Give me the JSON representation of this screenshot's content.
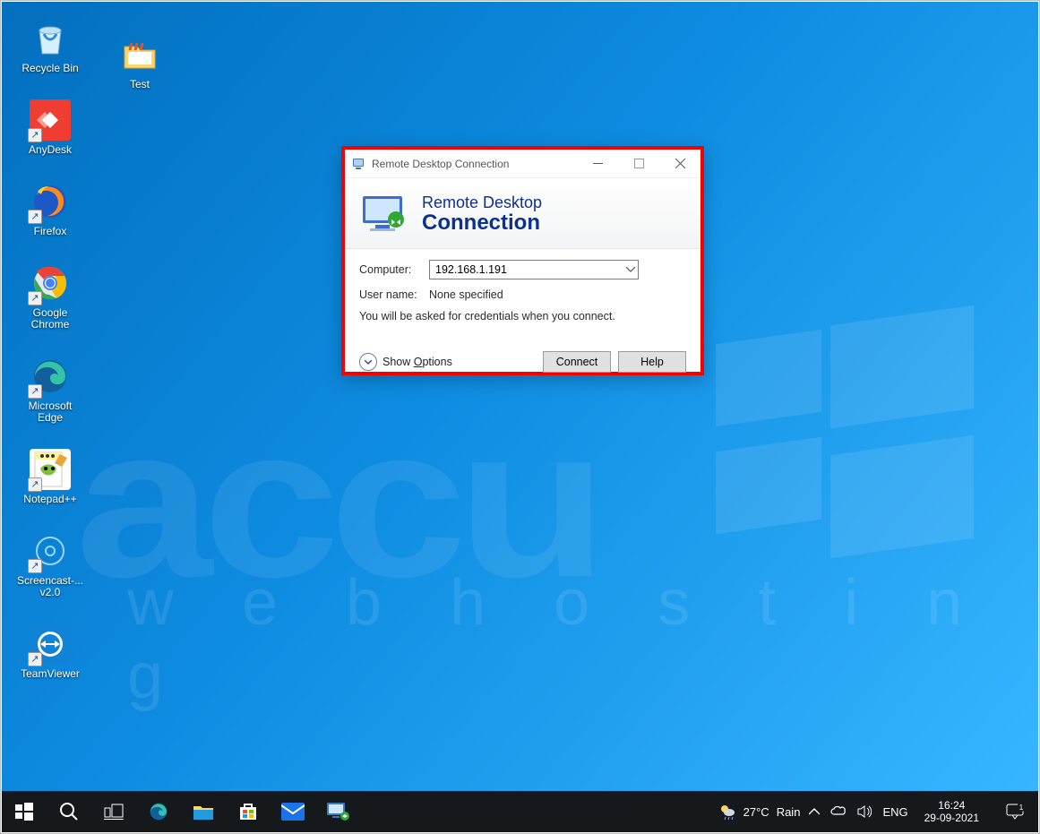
{
  "desktop": {
    "icons_col1": [
      {
        "name": "recycle-bin",
        "label": "Recycle Bin",
        "shortcut": false,
        "shape": "bin",
        "bg": "transparent"
      },
      {
        "name": "anydesk",
        "label": "AnyDesk",
        "shortcut": true,
        "shape": "anydesk",
        "bg": "#ef3e31"
      },
      {
        "name": "firefox",
        "label": "Firefox",
        "shortcut": true,
        "shape": "firefox",
        "bg": "transparent"
      },
      {
        "name": "google-chrome",
        "label": "Google Chrome",
        "shortcut": true,
        "shape": "chrome",
        "bg": "transparent"
      },
      {
        "name": "microsoft-edge",
        "label": "Microsoft Edge",
        "shortcut": true,
        "shape": "edge",
        "bg": "transparent"
      },
      {
        "name": "notepadpp",
        "label": "Notepad++",
        "shortcut": true,
        "shape": "npp",
        "bg": "#fff"
      },
      {
        "name": "screencast",
        "label": "Screencast-... v2.0",
        "shortcut": true,
        "shape": "screencast",
        "bg": "transparent"
      },
      {
        "name": "teamviewer",
        "label": "TeamViewer",
        "shortcut": true,
        "shape": "teamviewer",
        "bg": "#1183d6"
      }
    ],
    "icons_col2": [
      {
        "name": "test-folder",
        "label": "Test",
        "shortcut": false,
        "shape": "folder",
        "bg": "transparent"
      }
    ],
    "watermark_line1": "accu",
    "watermark_line2": "w  e  b      h  o  s  t  i  n  g"
  },
  "dialog": {
    "title": "Remote Desktop Connection",
    "banner_line1": "Remote Desktop",
    "banner_line2": "Connection",
    "computer_label": "Computer:",
    "computer_value": "192.168.1.191",
    "username_label": "User name:",
    "username_value": "None specified",
    "hint": "You will be asked for credentials when you connect.",
    "show_options": "Show Options",
    "connect": "Connect",
    "help": "Help"
  },
  "taskbar": {
    "left": [
      {
        "name": "start",
        "shape": "winstart"
      },
      {
        "name": "search",
        "shape": "search"
      },
      {
        "name": "task-view",
        "shape": "taskview"
      },
      {
        "name": "edge",
        "shape": "edge"
      },
      {
        "name": "file-explorer",
        "shape": "explorer"
      },
      {
        "name": "ms-store",
        "shape": "store"
      },
      {
        "name": "mail",
        "shape": "mail"
      },
      {
        "name": "rdc",
        "shape": "rdc"
      }
    ],
    "weather_temp": "27°C",
    "weather_cond": "Rain",
    "lang": "ENG",
    "time": "16:24",
    "date": "29-09-2021",
    "notif_count": "1"
  }
}
